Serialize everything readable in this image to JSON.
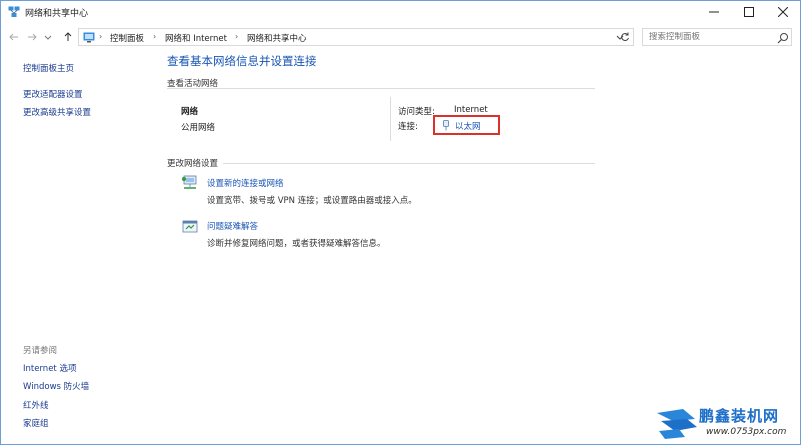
{
  "window": {
    "title": "网络和共享中心"
  },
  "address": {
    "crumbs": [
      "控制面板",
      "网络和 Internet",
      "网络和共享中心"
    ],
    "search_placeholder": "搜索控制面板"
  },
  "sidebar": {
    "top_links": [
      "控制面板主页",
      "更改适配器设置",
      "更改高级共享设置"
    ],
    "see_also_heading": "另请参阅",
    "see_also_links": [
      "Internet 选项",
      "Windows 防火墙",
      "红外线",
      "家庭组"
    ]
  },
  "main": {
    "title": "查看基本网络信息并设置连接",
    "active_section_label": "查看活动网络",
    "network_name": "网络",
    "network_type": "公用网络",
    "access_type_label": "访问类型:",
    "access_type_value": "Internet",
    "connections_label": "连接:",
    "connection_name": "以太网",
    "change_section_label": "更改网络设置",
    "tasks": [
      {
        "link": "设置新的连接或网络",
        "desc": "设置宽带、拨号或 VPN 连接；或设置路由器或接入点。",
        "icon": "new-connection-icon"
      },
      {
        "link": "问题疑难解答",
        "desc": "诊断并修复网络问题，或者获得疑难解答信息。",
        "icon": "troubleshoot-icon"
      }
    ]
  },
  "watermark": {
    "text": "鹏鑫装机网",
    "url": "www.0753px.com"
  },
  "colors": {
    "link": "#1a56b4",
    "title": "#1a56b4",
    "highlight_border": "#d8322a",
    "window_border": "#6b9fd6"
  }
}
